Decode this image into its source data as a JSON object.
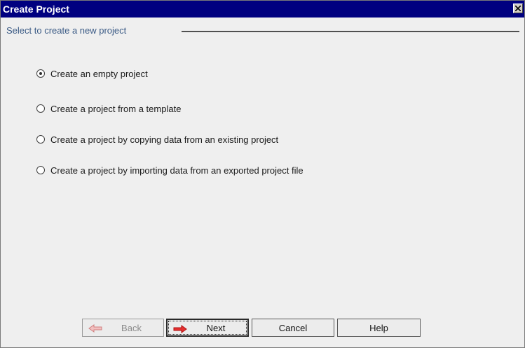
{
  "window": {
    "title": "Create Project"
  },
  "group": {
    "label": "Select to create a new project"
  },
  "options": [
    {
      "label": "Create an empty project",
      "selected": true
    },
    {
      "label": "Create a project from a template",
      "selected": false
    },
    {
      "label": "Create a project by copying data from an existing project",
      "selected": false
    },
    {
      "label": "Create a project by importing data from an exported project file",
      "selected": false
    }
  ],
  "buttons": {
    "back": "Back",
    "next": "Next",
    "cancel": "Cancel",
    "help": "Help"
  },
  "colors": {
    "title_bar": "#000080",
    "arrow_red": "#e02020",
    "arrow_disabled": "#e8a0a0"
  },
  "icons": {
    "back": "arrow-left-icon",
    "next": "arrow-right-icon",
    "close": "close-icon"
  }
}
